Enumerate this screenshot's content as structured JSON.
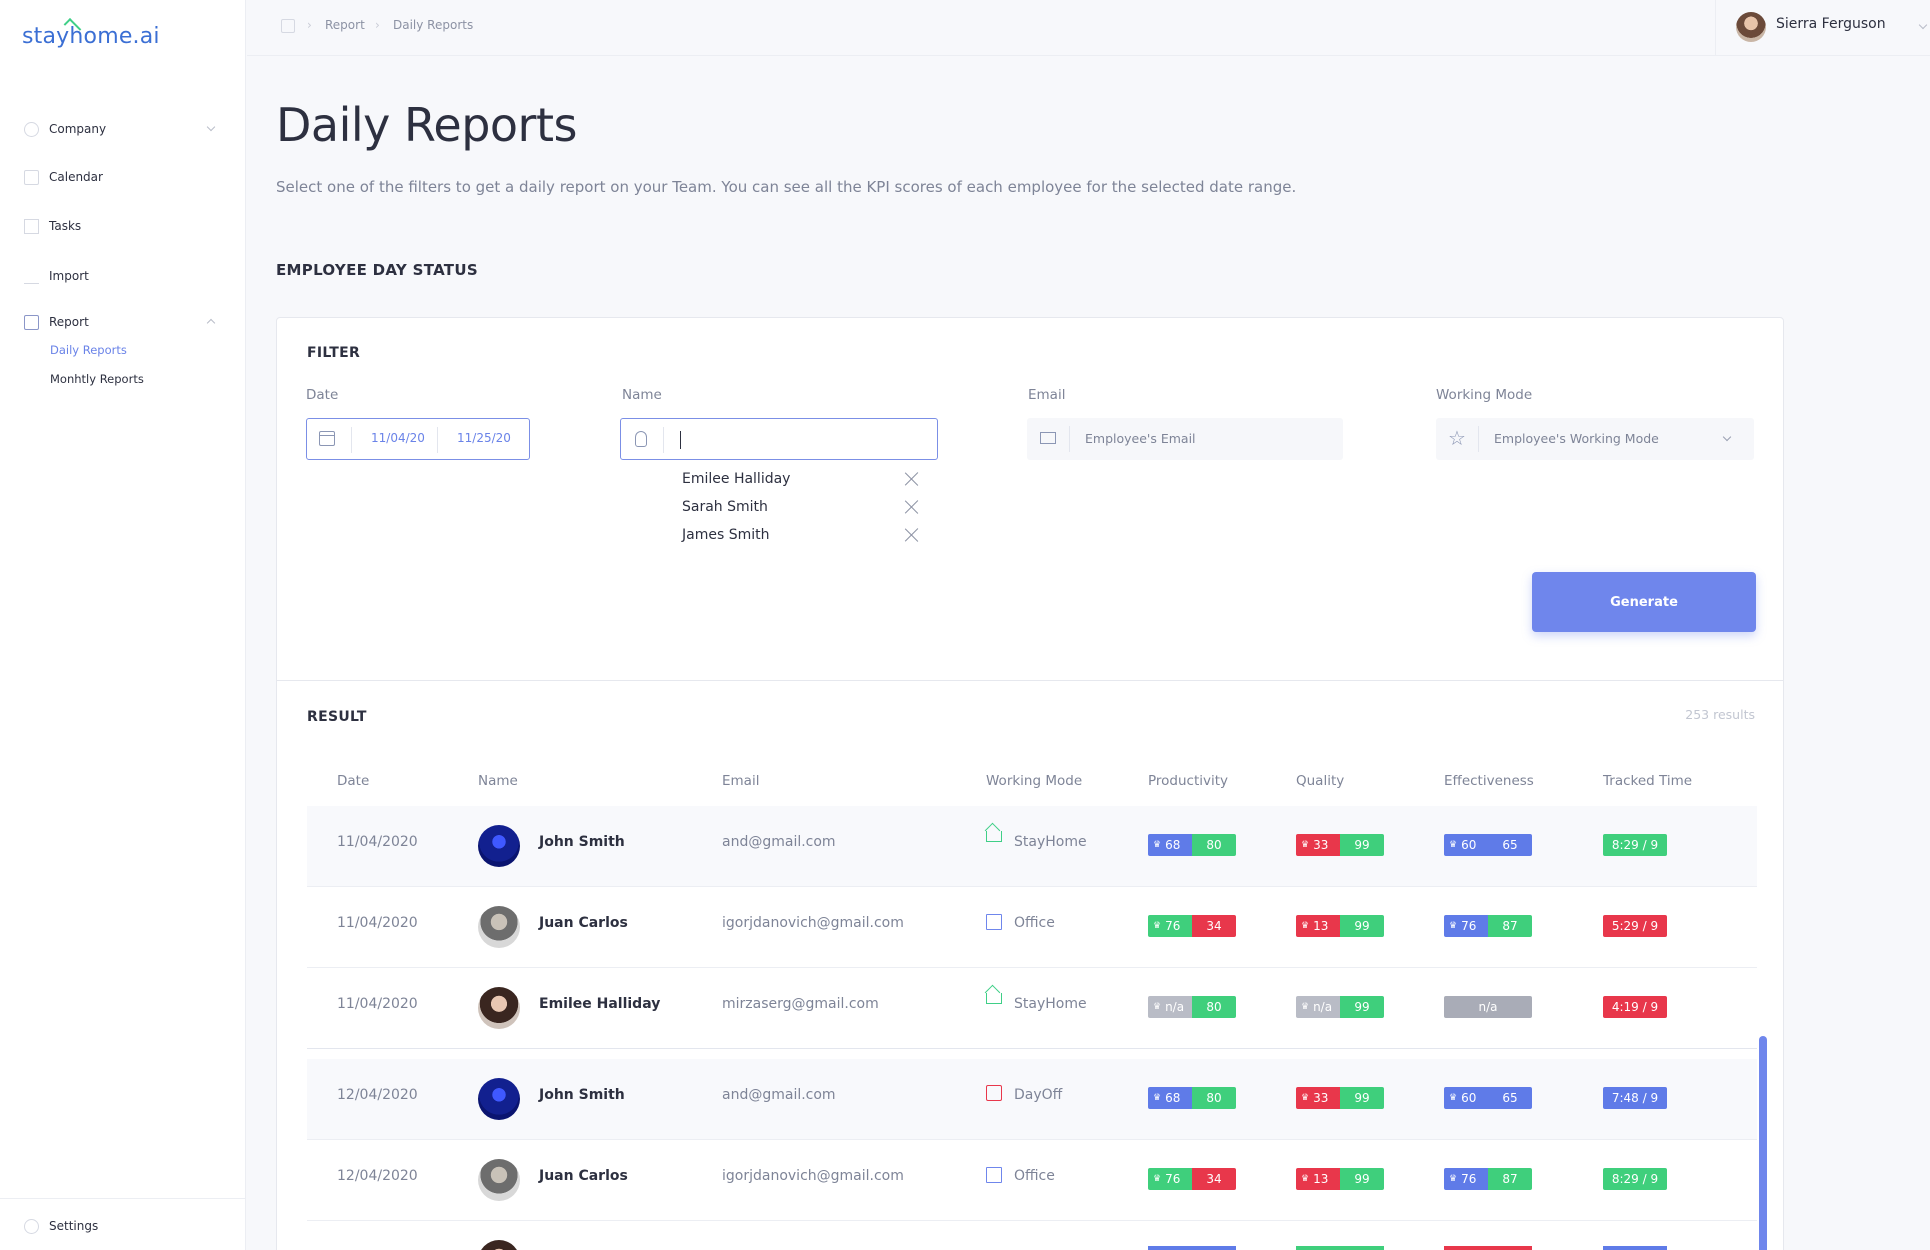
{
  "app": {
    "logo": "stayhome.ai"
  },
  "sidebar": {
    "items": [
      {
        "label": "Company",
        "icon": "building-icon"
      },
      {
        "label": "Calendar",
        "icon": "calendar-icon"
      },
      {
        "label": "Tasks",
        "icon": "tasks-icon"
      },
      {
        "label": "Import",
        "icon": "import-icon"
      },
      {
        "label": "Report",
        "icon": "report-icon"
      }
    ],
    "report_sub": [
      "Daily Reports",
      "Monhtly Reports"
    ],
    "settings": "Settings"
  },
  "topbar": {
    "breadcrumb": [
      "Report",
      "Daily Reports"
    ],
    "user_name": "Sierra Ferguson"
  },
  "page": {
    "title": "Daily Reports",
    "description": "Select one of the filters to get a daily report on your Team. You can see all the KPI scores of each employee for the selected date range.",
    "section_title": "EMPLOYEE DAY STATUS"
  },
  "filter": {
    "title": "FILTER",
    "date_label": "Date",
    "date_from": "11/04/20",
    "date_to": "11/25/20",
    "name_label": "Name",
    "name_value": "",
    "selected_names": [
      "Emilee Halliday",
      "Sarah Smith",
      "James Smith"
    ],
    "email_label": "Email",
    "email_placeholder": "Employee's Email",
    "mode_label": "Working Mode",
    "mode_placeholder": "Employee's Working Mode",
    "generate_label": "Generate"
  },
  "result": {
    "title": "RESULT",
    "count": "253 results",
    "columns": [
      "Date",
      "Name",
      "Email",
      "Working Mode",
      "Productivity",
      "Quality",
      "Effectiveness",
      "Tracked Time"
    ],
    "rows": [
      {
        "date": "11/04/2020",
        "name": "John Smith",
        "email": "and@gmail.com",
        "mode": "StayHome",
        "productivity": [
          "68",
          "80"
        ],
        "quality": [
          "33",
          "99"
        ],
        "effectiveness": [
          "60",
          "65"
        ],
        "time": "8:29 / 9"
      },
      {
        "date": "11/04/2020",
        "name": "Juan Carlos",
        "email": "igorjdanovich@gmail.com",
        "mode": "Office",
        "productivity": [
          "76",
          "34"
        ],
        "quality": [
          "13",
          "99"
        ],
        "effectiveness": [
          "76",
          "87"
        ],
        "time": "5:29 / 9"
      },
      {
        "date": "11/04/2020",
        "name": "Emilee Halliday",
        "email": "mirzaserg@gmail.com",
        "mode": "StayHome",
        "productivity": [
          "n/a",
          "80"
        ],
        "quality": [
          "n/a",
          "99"
        ],
        "effectiveness": [
          "n/a"
        ],
        "time": "4:19 / 9"
      },
      {
        "date": "12/04/2020",
        "name": "John Smith",
        "email": "and@gmail.com",
        "mode": "DayOff",
        "productivity": [
          "68",
          "80"
        ],
        "quality": [
          "33",
          "99"
        ],
        "effectiveness": [
          "60",
          "65"
        ],
        "time": "7:48 / 9"
      },
      {
        "date": "12/04/2020",
        "name": "Juan Carlos",
        "email": "igorjdanovich@gmail.com",
        "mode": "Office",
        "productivity": [
          "76",
          "34"
        ],
        "quality": [
          "13",
          "99"
        ],
        "effectiveness": [
          "76",
          "87"
        ],
        "time": "8:29 / 9"
      }
    ]
  },
  "colors": {
    "accent": "#6f86ec",
    "green": "#3fcf7c",
    "red": "#e8374b",
    "blue": "#5f7be8",
    "grey": "#b9bcc6"
  }
}
